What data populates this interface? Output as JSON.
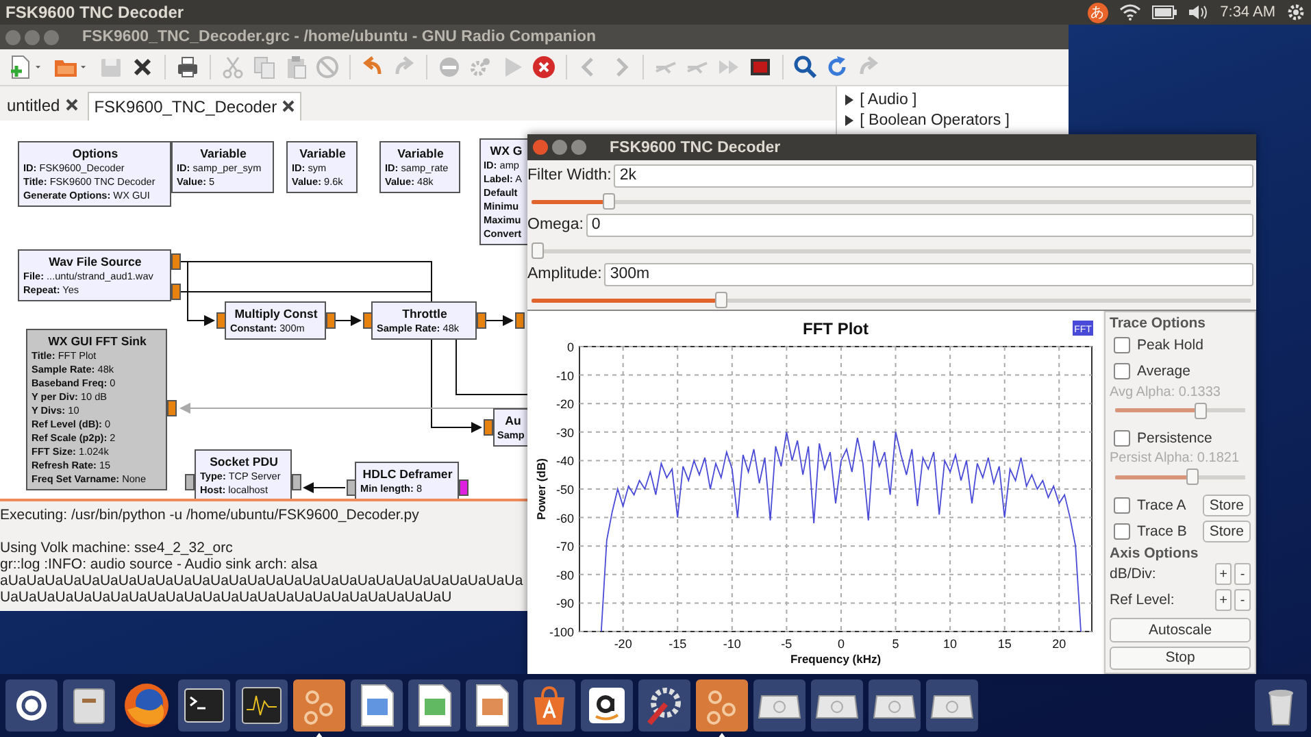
{
  "top_bar": {
    "app_title": "FSK9600 TNC Decoder",
    "input_method": "あ",
    "clock": "7:34 AM"
  },
  "grc_window": {
    "title": "FSK9600_TNC_Decoder.grc - /home/ubuntu - GNU Radio Companion",
    "tabs": [
      {
        "label": "untitled",
        "selected": false
      },
      {
        "label": "FSK9600_TNC_Decoder",
        "selected": true
      }
    ],
    "block_tree": [
      {
        "label": "[ Audio ]",
        "expanded": false
      },
      {
        "label": "[ Boolean Operators ]",
        "expanded": false
      }
    ],
    "blocks": [
      {
        "title": "Options",
        "disabled": false,
        "params": [
          {
            "key": "ID:",
            "value": "FSK9600_Decoder"
          },
          {
            "key": "Title:",
            "value": "FSK9600 TNC Decoder"
          },
          {
            "key": "Generate Options:",
            "value": "WX GUI"
          }
        ]
      },
      {
        "title": "Variable",
        "disabled": false,
        "params": [
          {
            "key": "ID:",
            "value": "samp_per_sym"
          },
          {
            "key": "Value:",
            "value": "5"
          }
        ]
      },
      {
        "title": "Variable",
        "disabled": false,
        "params": [
          {
            "key": "ID:",
            "value": "sym"
          },
          {
            "key": "Value:",
            "value": "9.6k"
          }
        ]
      },
      {
        "title": "Variable",
        "disabled": false,
        "params": [
          {
            "key": "ID:",
            "value": "samp_rate"
          },
          {
            "key": "Value:",
            "value": "48k"
          }
        ]
      },
      {
        "title": "WX G",
        "disabled": false,
        "params": [
          {
            "key": "ID:",
            "value": "amp"
          },
          {
            "key": "Label:",
            "value": "A"
          },
          {
            "key": "Default"
          },
          {
            "key": "Minimu"
          },
          {
            "key": "Maximu"
          },
          {
            "key": "Convert"
          }
        ]
      },
      {
        "title": "Wav File Source",
        "disabled": false,
        "params": [
          {
            "key": "File:",
            "value": "...untu/strand_aud1.wav"
          },
          {
            "key": "Repeat:",
            "value": "Yes"
          }
        ]
      },
      {
        "title": "Multiply Const",
        "disabled": false,
        "params": [
          {
            "key": "Constant:",
            "value": "300m"
          }
        ]
      },
      {
        "title": "Throttle",
        "disabled": false,
        "params": [
          {
            "key": "Sample Rate:",
            "value": "48k"
          }
        ]
      },
      {
        "title": "WX GUI FFT Sink",
        "disabled": true,
        "params": [
          {
            "key": "Title:",
            "value": "FFT Plot"
          },
          {
            "key": "Sample Rate:",
            "value": "48k"
          },
          {
            "key": "Baseband Freq:",
            "value": "0"
          },
          {
            "key": "Y per Div:",
            "value": "10 dB"
          },
          {
            "key": "Y Divs:",
            "value": "10"
          },
          {
            "key": "Ref Level (dB):",
            "value": "0"
          },
          {
            "key": "Ref Scale (p2p):",
            "value": "2"
          },
          {
            "key": "FFT Size:",
            "value": "1.024k"
          },
          {
            "key": "Refresh Rate:",
            "value": "15"
          },
          {
            "key": "Freq Set Varname:",
            "value": "None"
          }
        ]
      },
      {
        "title": "Socket PDU",
        "disabled": false,
        "params": [
          {
            "key": "Type:",
            "value": "TCP Server"
          },
          {
            "key": "Host:",
            "value": "localhost"
          }
        ]
      },
      {
        "title": "HDLC Deframer",
        "disabled": false,
        "params": [
          {
            "key": "Min length:",
            "value": "8"
          }
        ]
      },
      {
        "title": "Au",
        "disabled": false,
        "params": [
          {
            "key": "Samp"
          }
        ]
      }
    ],
    "console": {
      "command": "Executing: /usr/bin/python -u /home/ubuntu/FSK9600_Decoder.py",
      "output_lines": [
        "Using Volk machine: sse4_2_32_orc",
        "gr::log :INFO: audio source - Audio sink arch: alsa",
        "aUaUaUaUaUaUaUaUaUaUaUaUaUaUaUaUaUaUaUaUaUaUaUaUaUaUaUaUa",
        "UaUaUaUaUaUaUaUaUaUaUaUaUaUaUaUaUaUaUaUaUaUaUaUaU"
      ]
    }
  },
  "decoder_window": {
    "title": "FSK9600 TNC Decoder",
    "controls": [
      {
        "label": "Filter Width:",
        "value": "2k",
        "level": 0.1
      },
      {
        "label": "Omega:",
        "value": "0",
        "level": 0
      },
      {
        "label": "Amplitude:",
        "value": "300m",
        "level": 0.26
      }
    ],
    "plot": {
      "chart_data": {
        "type": "line",
        "title": "FFT Plot",
        "xlabel": "Frequency (kHz)",
        "ylabel": "Power (dB)",
        "xlim": [
          -24,
          23
        ],
        "ylim": [
          -100,
          0
        ],
        "grid": true,
        "xticks": [
          -20,
          -15,
          -10,
          -5,
          0,
          5,
          10,
          15,
          20
        ],
        "yticks": [
          0,
          -10,
          -20,
          -30,
          -40,
          -50,
          -60,
          -70,
          -80,
          -90,
          -100
        ],
        "x": [
          -22,
          -21.5,
          -21,
          -20.5,
          -20,
          -19.5,
          -19,
          -18.5,
          -18,
          -17.5,
          -17,
          -16.5,
          -16,
          -15.5,
          -15,
          -14.5,
          -14,
          -13.5,
          -13,
          -12.5,
          -12,
          -11.5,
          -11,
          -10.5,
          -10,
          -9.5,
          -9,
          -8.5,
          -8,
          -7.5,
          -7,
          -6.5,
          -6,
          -5.5,
          -5,
          -4.5,
          -4,
          -3.5,
          -3,
          -2.5,
          -2,
          -1.5,
          -1,
          -0.5,
          0,
          0.5,
          1,
          1.5,
          2,
          2.5,
          3,
          3.5,
          4,
          4.5,
          5,
          5.5,
          6,
          6.5,
          7,
          7.5,
          8,
          8.5,
          9,
          9.5,
          10,
          10.5,
          11,
          11.5,
          12,
          12.5,
          13,
          13.5,
          14,
          14.5,
          15,
          15.5,
          16,
          16.5,
          17,
          17.5,
          18,
          18.5,
          19,
          19.5,
          20,
          20.5,
          21,
          21.5,
          22
        ],
        "series": [
          {
            "name": "FFT",
            "color": "#4a4ad8",
            "values": [
              -100,
              -68,
              -58,
              -50,
              -56,
              -49,
              -52,
              -47,
              -50,
              -44,
              -52,
              -41,
              -46,
              -43,
              -60,
              -42,
              -47,
              -40,
              -45,
              -39,
              -50,
              -41,
              -46,
              -37,
              -43,
              -60,
              -38,
              -44,
              -36,
              -48,
              -39,
              -61,
              -35,
              -42,
              -30,
              -40,
              -33,
              -45,
              -35,
              -62,
              -34,
              -43,
              -37,
              -55,
              -40,
              -36,
              -44,
              -32,
              -41,
              -61,
              -33,
              -42,
              -37,
              -52,
              -30,
              -38,
              -45,
              -36,
              -56,
              -39,
              -43,
              -37,
              -59,
              -40,
              -44,
              -38,
              -47,
              -40,
              -55,
              -41,
              -46,
              -39,
              -48,
              -42,
              -60,
              -43,
              -47,
              -39,
              -49,
              -45,
              -50,
              -47,
              -53,
              -49,
              -55,
              -52,
              -60,
              -70,
              -100
            ]
          }
        ]
      }
    },
    "trace_options": {
      "title": "Trace Options",
      "items": [
        {
          "kind": "checkbox",
          "label": "Peak Hold",
          "checked": false
        },
        {
          "kind": "checkbox",
          "label": "Average",
          "checked": false
        },
        {
          "kind": "slider",
          "label": "Avg Alpha: 0.1333",
          "disabled": true,
          "level": 0.68
        },
        {
          "kind": "checkbox",
          "label": "Persistence",
          "checked": false
        },
        {
          "kind": "slider",
          "label": "Persist Alpha: 0.1821",
          "disabled": true,
          "level": 0.6
        },
        {
          "kind": "store",
          "label": "Trace A",
          "checked": false,
          "button": "Store"
        },
        {
          "kind": "store",
          "label": "Trace B",
          "checked": false,
          "button": "Store"
        }
      ]
    },
    "axis_options": {
      "title": "Axis Options",
      "rows": [
        {
          "label": "dB/Div:",
          "plus": "+",
          "minus": "-"
        },
        {
          "label": "Ref Level:",
          "plus": "+",
          "minus": "-"
        }
      ]
    },
    "buttons": [
      "Autoscale",
      "Stop"
    ]
  },
  "dock": {
    "items": [
      {
        "kind": "ubuntu",
        "running": false
      },
      {
        "kind": "files",
        "running": false
      },
      {
        "kind": "browser",
        "running": false
      },
      {
        "kind": "terminal",
        "running": false
      },
      {
        "kind": "monitor",
        "running": false
      },
      {
        "kind": "grc",
        "running": true
      },
      {
        "kind": "writer",
        "running": false
      },
      {
        "kind": "calc",
        "running": false
      },
      {
        "kind": "impress",
        "running": false
      },
      {
        "kind": "software",
        "running": false
      },
      {
        "kind": "amazon",
        "running": false
      },
      {
        "kind": "settings",
        "running": false
      },
      {
        "kind": "grc",
        "running": true
      },
      {
        "kind": "drive",
        "running": false
      },
      {
        "kind": "drive",
        "running": false
      },
      {
        "kind": "drive",
        "running": false
      },
      {
        "kind": "drive",
        "running": false
      }
    ]
  }
}
